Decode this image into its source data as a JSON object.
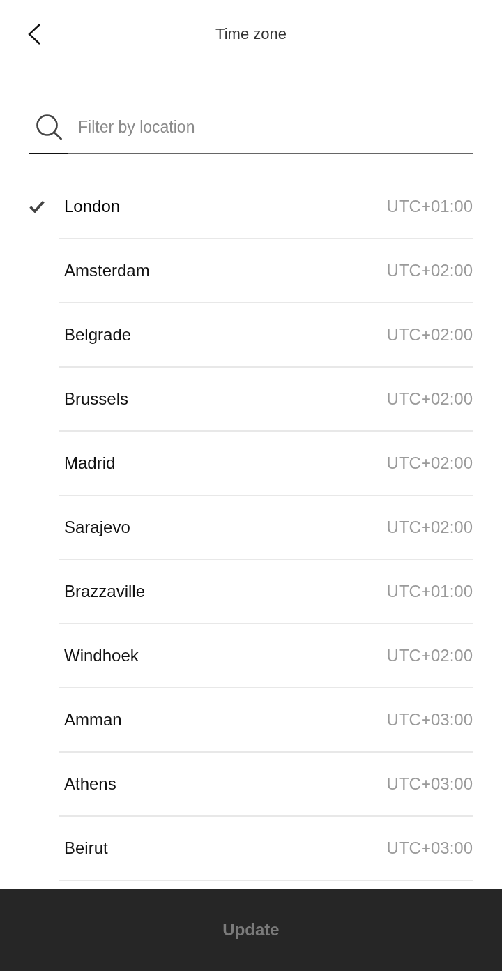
{
  "header": {
    "title": "Time zone"
  },
  "search": {
    "placeholder": "Filter by location"
  },
  "timezones": [
    {
      "city": "London",
      "offset": "UTC+01:00",
      "selected": true
    },
    {
      "city": "Amsterdam",
      "offset": "UTC+02:00",
      "selected": false
    },
    {
      "city": "Belgrade",
      "offset": "UTC+02:00",
      "selected": false
    },
    {
      "city": "Brussels",
      "offset": "UTC+02:00",
      "selected": false
    },
    {
      "city": "Madrid",
      "offset": "UTC+02:00",
      "selected": false
    },
    {
      "city": "Sarajevo",
      "offset": "UTC+02:00",
      "selected": false
    },
    {
      "city": "Brazzaville",
      "offset": "UTC+01:00",
      "selected": false
    },
    {
      "city": "Windhoek",
      "offset": "UTC+02:00",
      "selected": false
    },
    {
      "city": "Amman",
      "offset": "UTC+03:00",
      "selected": false
    },
    {
      "city": "Athens",
      "offset": "UTC+03:00",
      "selected": false
    },
    {
      "city": "Beirut",
      "offset": "UTC+03:00",
      "selected": false
    }
  ],
  "update_button": {
    "label": "Update",
    "disabled": true
  }
}
